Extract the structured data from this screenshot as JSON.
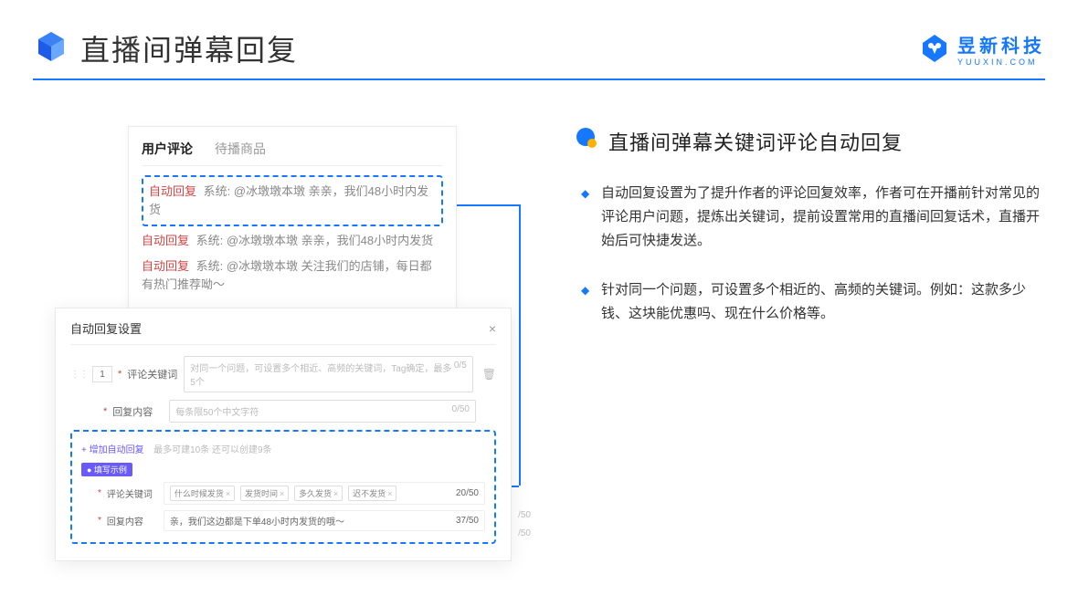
{
  "page": {
    "title": "直播间弹幕回复"
  },
  "brand": {
    "cn": "昱新科技",
    "en": "YUUXIN.COM"
  },
  "comments_card": {
    "tabs": {
      "active": "用户评论",
      "inactive": "待播商品"
    },
    "highlighted": {
      "ar": "自动回复",
      "text": "系统: @冰墩墩本墩 亲亲，我们48小时内发货"
    },
    "line2": {
      "ar": "自动回复",
      "text": "系统: @冰墩墩本墩 亲亲，我们48小时内发货"
    },
    "line3": {
      "ar": "自动回复",
      "text": "系统: @冰墩墩本墩 关注我们的店铺，每日都有热门推荐呦～"
    }
  },
  "settings_modal": {
    "title": "自动回复设置",
    "index": "1",
    "keyword_label": "评论关键词",
    "keyword_placeholder": "对同一个问题，可设置多个相近、高频的关键词，Tag确定，最多5个",
    "keyword_count": "0/5",
    "content_label": "回复内容",
    "content_placeholder": "每条限50个中文字符",
    "content_count": "0/50",
    "add_link": "+ 增加自动回复",
    "add_hint": "最多可建10条  还可以创建9条",
    "example_badge": "● 填写示例",
    "example_kw_label": "评论关键词",
    "example_tags": [
      "什么时候发货",
      "发货时间",
      "多久发货",
      "迟不发货"
    ],
    "example_kw_count": "20/50",
    "example_content_label": "回复内容",
    "example_content": "亲，我们这边都是下单48小时内发货的哦～",
    "example_content_count": "37/50",
    "side_count": "/50",
    "side_count2": "/50"
  },
  "right": {
    "title": "直播间弹幕关键词评论自动回复",
    "bullets": [
      "自动回复设置为了提升作者的评论回复效率，作者可在开播前针对常见的评论用户问题，提炼出关键词，提前设置常用的直播间回复话术，直播开始后可快捷发送。",
      "针对同一个问题，可设置多个相近的、高频的关键词。例如：这款多少钱、这块能优惠吗、现在什么价格等。"
    ]
  }
}
